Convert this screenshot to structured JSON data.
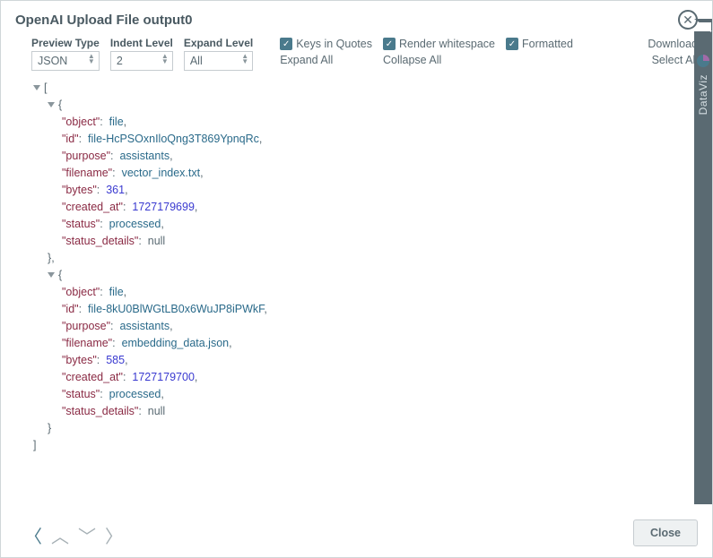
{
  "title": "OpenAI Upload File output0",
  "controls": {
    "preview_type_label": "Preview Type",
    "preview_type_value": "JSON",
    "indent_label": "Indent Level",
    "indent_value": "2",
    "expand_label": "Expand Level",
    "expand_value": "All",
    "cb_keys": "Keys in Quotes",
    "cb_ws": "Render whitespace",
    "cb_fmt": "Formatted",
    "expand_all": "Expand All",
    "collapse_all": "Collapse All",
    "download": "Download",
    "select_all": "Select All"
  },
  "json": [
    {
      "object": "file",
      "id": "file-HcPSOxnIloQng3T869YpnqRc",
      "purpose": "assistants",
      "filename": "vector_index.txt",
      "bytes": 361,
      "created_at": 1727179699,
      "status": "processed",
      "status_details": null
    },
    {
      "object": "file",
      "id": "file-8kU0BlWGtLB0x6WuJP8iPWkF",
      "purpose": "assistants",
      "filename": "embedding_data.json",
      "bytes": 585,
      "created_at": 1727179700,
      "status": "processed",
      "status_details": null
    }
  ],
  "close_label": "Close",
  "side_label": "DataViz"
}
